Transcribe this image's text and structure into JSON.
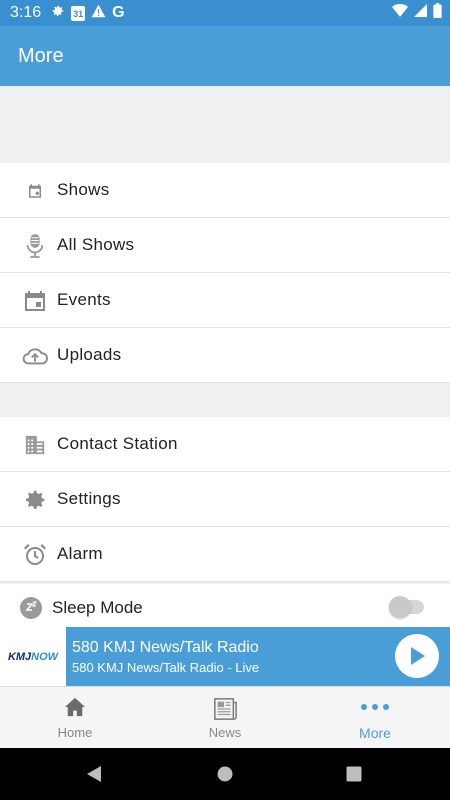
{
  "status_bar": {
    "time": "3:16",
    "calendar_day": "31",
    "google_letter": "G"
  },
  "header": {
    "title": "More"
  },
  "menu": {
    "group1": [
      {
        "label": "Shows",
        "icon": "calendar-small-icon"
      },
      {
        "label": "All Shows",
        "icon": "microphone-icon"
      },
      {
        "label": "Events",
        "icon": "calendar-icon"
      },
      {
        "label": "Uploads",
        "icon": "cloud-upload-icon"
      }
    ],
    "group2": [
      {
        "label": "Contact Station",
        "icon": "building-icon"
      },
      {
        "label": "Settings",
        "icon": "gear-icon"
      },
      {
        "label": "Alarm",
        "icon": "alarm-clock-icon"
      }
    ],
    "sleep_mode": {
      "label": "Sleep Mode",
      "icon": "sleep-clock-icon",
      "enabled": false
    }
  },
  "player": {
    "logo_text": "KMJ",
    "logo_text_accent": "NOW",
    "station_name": "580 KMJ News/Talk Radio",
    "stream_label": "580 KMJ News/Talk Radio - Live"
  },
  "tabs": [
    {
      "label": "Home",
      "icon": "home-icon",
      "active": false
    },
    {
      "label": "News",
      "icon": "newspaper-icon",
      "active": false
    },
    {
      "label": "More",
      "icon": "more-dots-icon",
      "active": true
    }
  ],
  "colors": {
    "status_bar": "#3a8fd0",
    "app_bar": "#4a9ed8",
    "accent": "#4a9ed8",
    "icon_gray": "#8a8a8a",
    "background": "#f0f0f2"
  }
}
